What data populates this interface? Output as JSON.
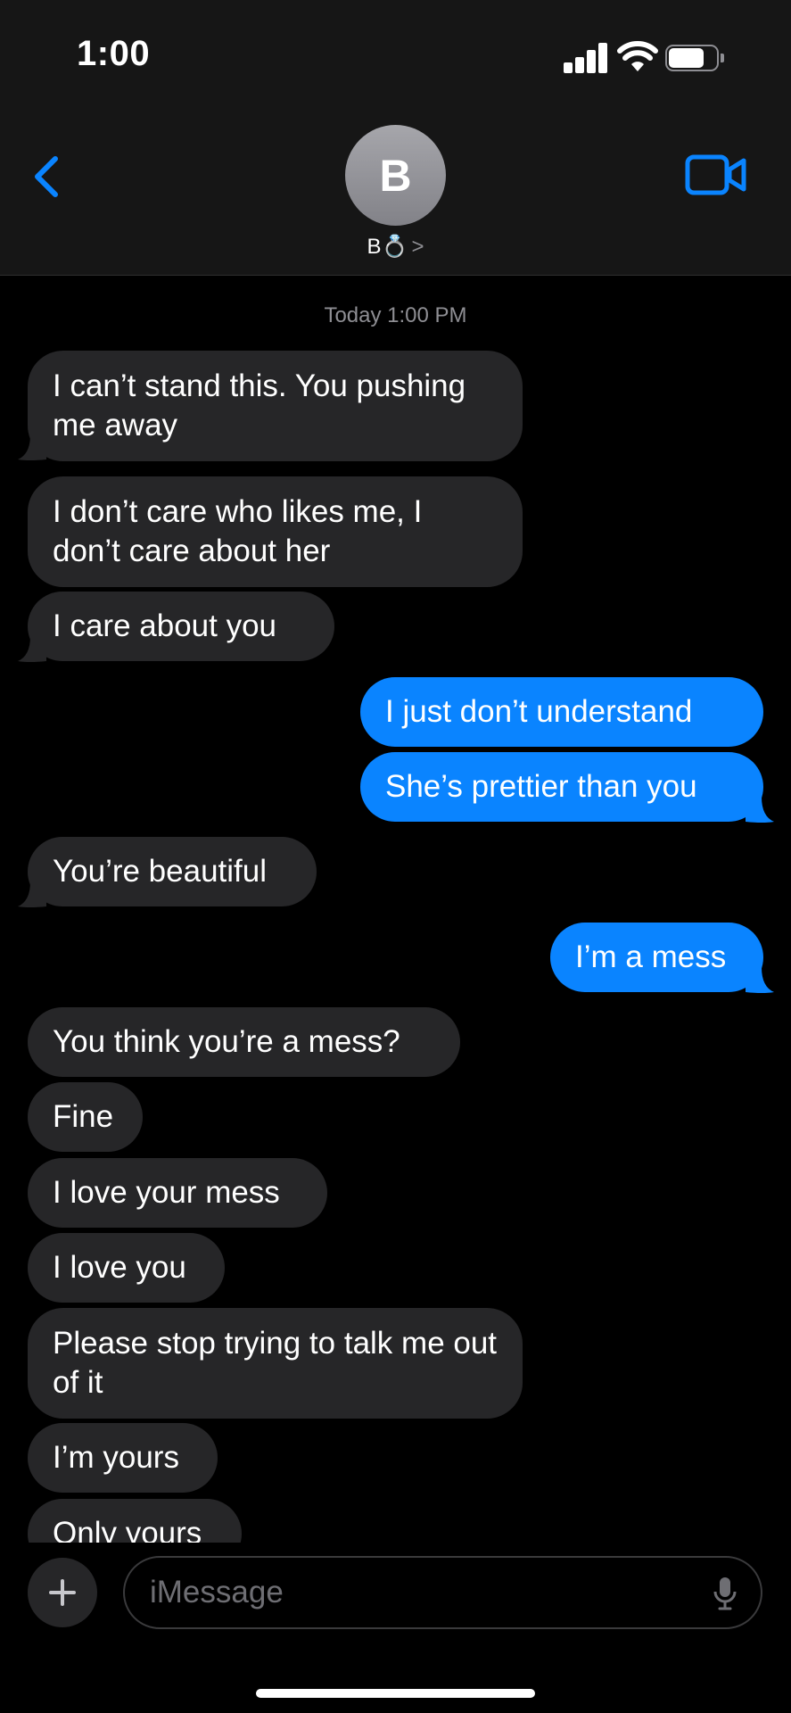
{
  "status_bar": {
    "time": "1:00",
    "battery_level": 0.75
  },
  "header": {
    "avatar_letter": "B",
    "contact_name": "B",
    "contact_emoji": "💍",
    "chevron": ">"
  },
  "conversation": {
    "timestamp": "Today 1:00 PM",
    "messages": [
      {
        "from": "them",
        "text": "I can’t stand this. You pushing me away"
      },
      {
        "from": "them",
        "text": "I don’t care who likes me, I don’t care about her"
      },
      {
        "from": "them",
        "text": "I care about you"
      },
      {
        "from": "me",
        "text": "I just don’t understand"
      },
      {
        "from": "me",
        "text": "She’s prettier than you"
      },
      {
        "from": "them",
        "text": "You’re beautiful"
      },
      {
        "from": "me",
        "text": "I’m a mess"
      },
      {
        "from": "them",
        "text": "You think you’re a mess?"
      },
      {
        "from": "them",
        "text": "Fine"
      },
      {
        "from": "them",
        "text": "I love your mess"
      },
      {
        "from": "them",
        "text": "I love you"
      },
      {
        "from": "them",
        "text": "Please stop trying to talk me out of it"
      },
      {
        "from": "them",
        "text": "I’m yours"
      },
      {
        "from": "them",
        "text": "Only yours"
      }
    ]
  },
  "composer": {
    "placeholder": "iMessage"
  },
  "colors": {
    "accent": "#0a84ff",
    "incoming_bubble": "#262628",
    "header_bg": "#161616"
  }
}
